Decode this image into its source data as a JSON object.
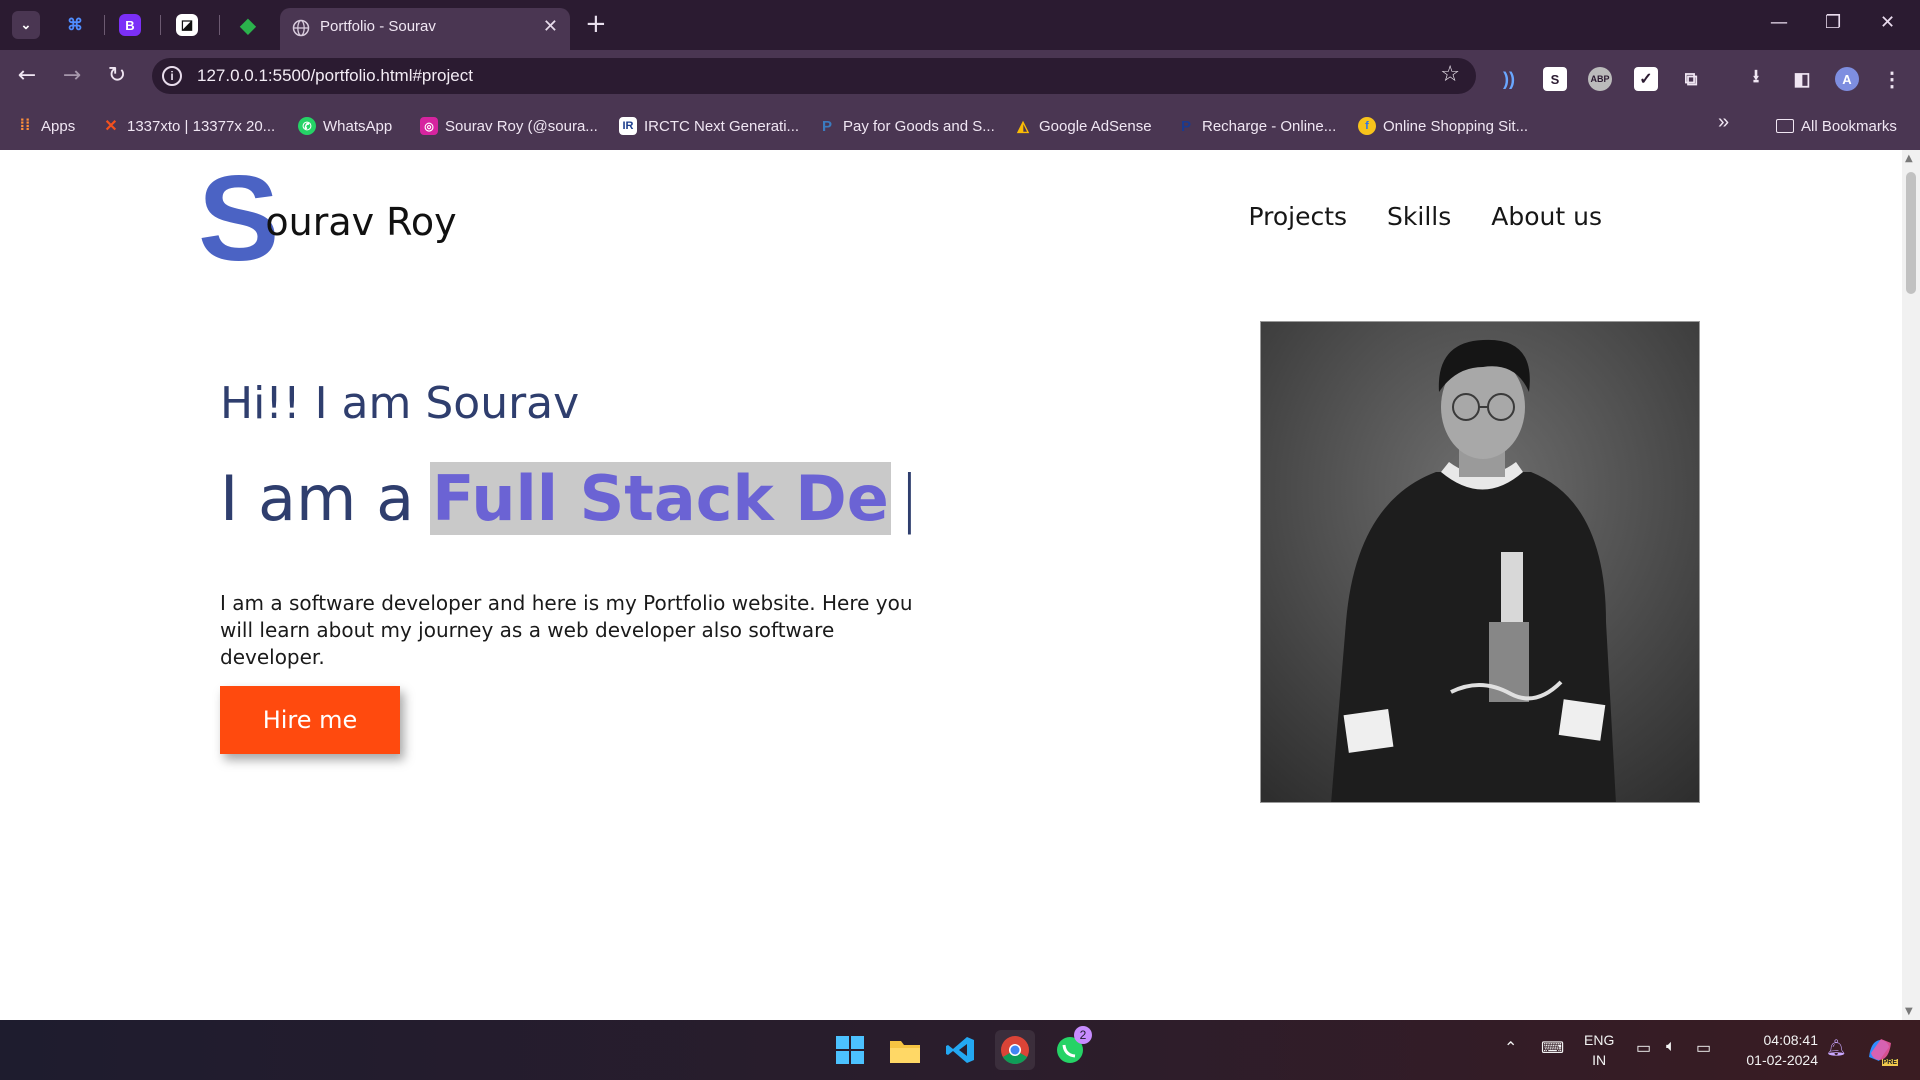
{
  "browser": {
    "tab_title": "Portfolio - Sourav",
    "url": "127.0.0.1:5500/portfolio.html#project",
    "bookmarks": [
      {
        "label": "Apps",
        "icon": "apps-grid-icon"
      },
      {
        "label": "1337xto | 13377x 20...",
        "icon": "1337x-icon"
      },
      {
        "label": "WhatsApp",
        "icon": "whatsapp-icon"
      },
      {
        "label": "Sourav Roy (@soura...",
        "icon": "instagram-icon"
      },
      {
        "label": "IRCTC Next Generati...",
        "icon": "irctc-icon"
      },
      {
        "label": "Pay for Goods and S...",
        "icon": "paypal-icon"
      },
      {
        "label": "Google AdSense",
        "icon": "adsense-icon"
      },
      {
        "label": "Recharge - Online...",
        "icon": "paytm-icon"
      },
      {
        "label": "Online Shopping Sit...",
        "icon": "flipkart-icon"
      }
    ],
    "all_bookmarks": "All Bookmarks",
    "more_bookmarks": "»"
  },
  "site": {
    "logo_letter": "S",
    "logo_rest": "ourav Roy",
    "nav": [
      "Projects",
      "Skills",
      "About us"
    ],
    "greeting": "Hi!! I am Sourav",
    "role_prefix": "I am a",
    "role_typed": "Full Stack De",
    "cursor": "|",
    "description": "I am a software developer and here is my Portfolio website. Here you will learn about my journey as a web developer also software developer.",
    "hire_button": "Hire me"
  },
  "taskbar": {
    "lang_line1": "ENG",
    "lang_line2": "IN",
    "time": "04:08:41",
    "date": "01-02-2024",
    "whatsapp_badge": "2",
    "copilot_label": "PRE"
  },
  "colors": {
    "accent_blue": "#4b63c4",
    "typed_purple": "#6b63d4",
    "hire_orange": "#ff4a0e",
    "heading_navy": "#2f3e6e",
    "chrome_dark": "#2b1b31",
    "chrome_mid": "#4a3652"
  }
}
